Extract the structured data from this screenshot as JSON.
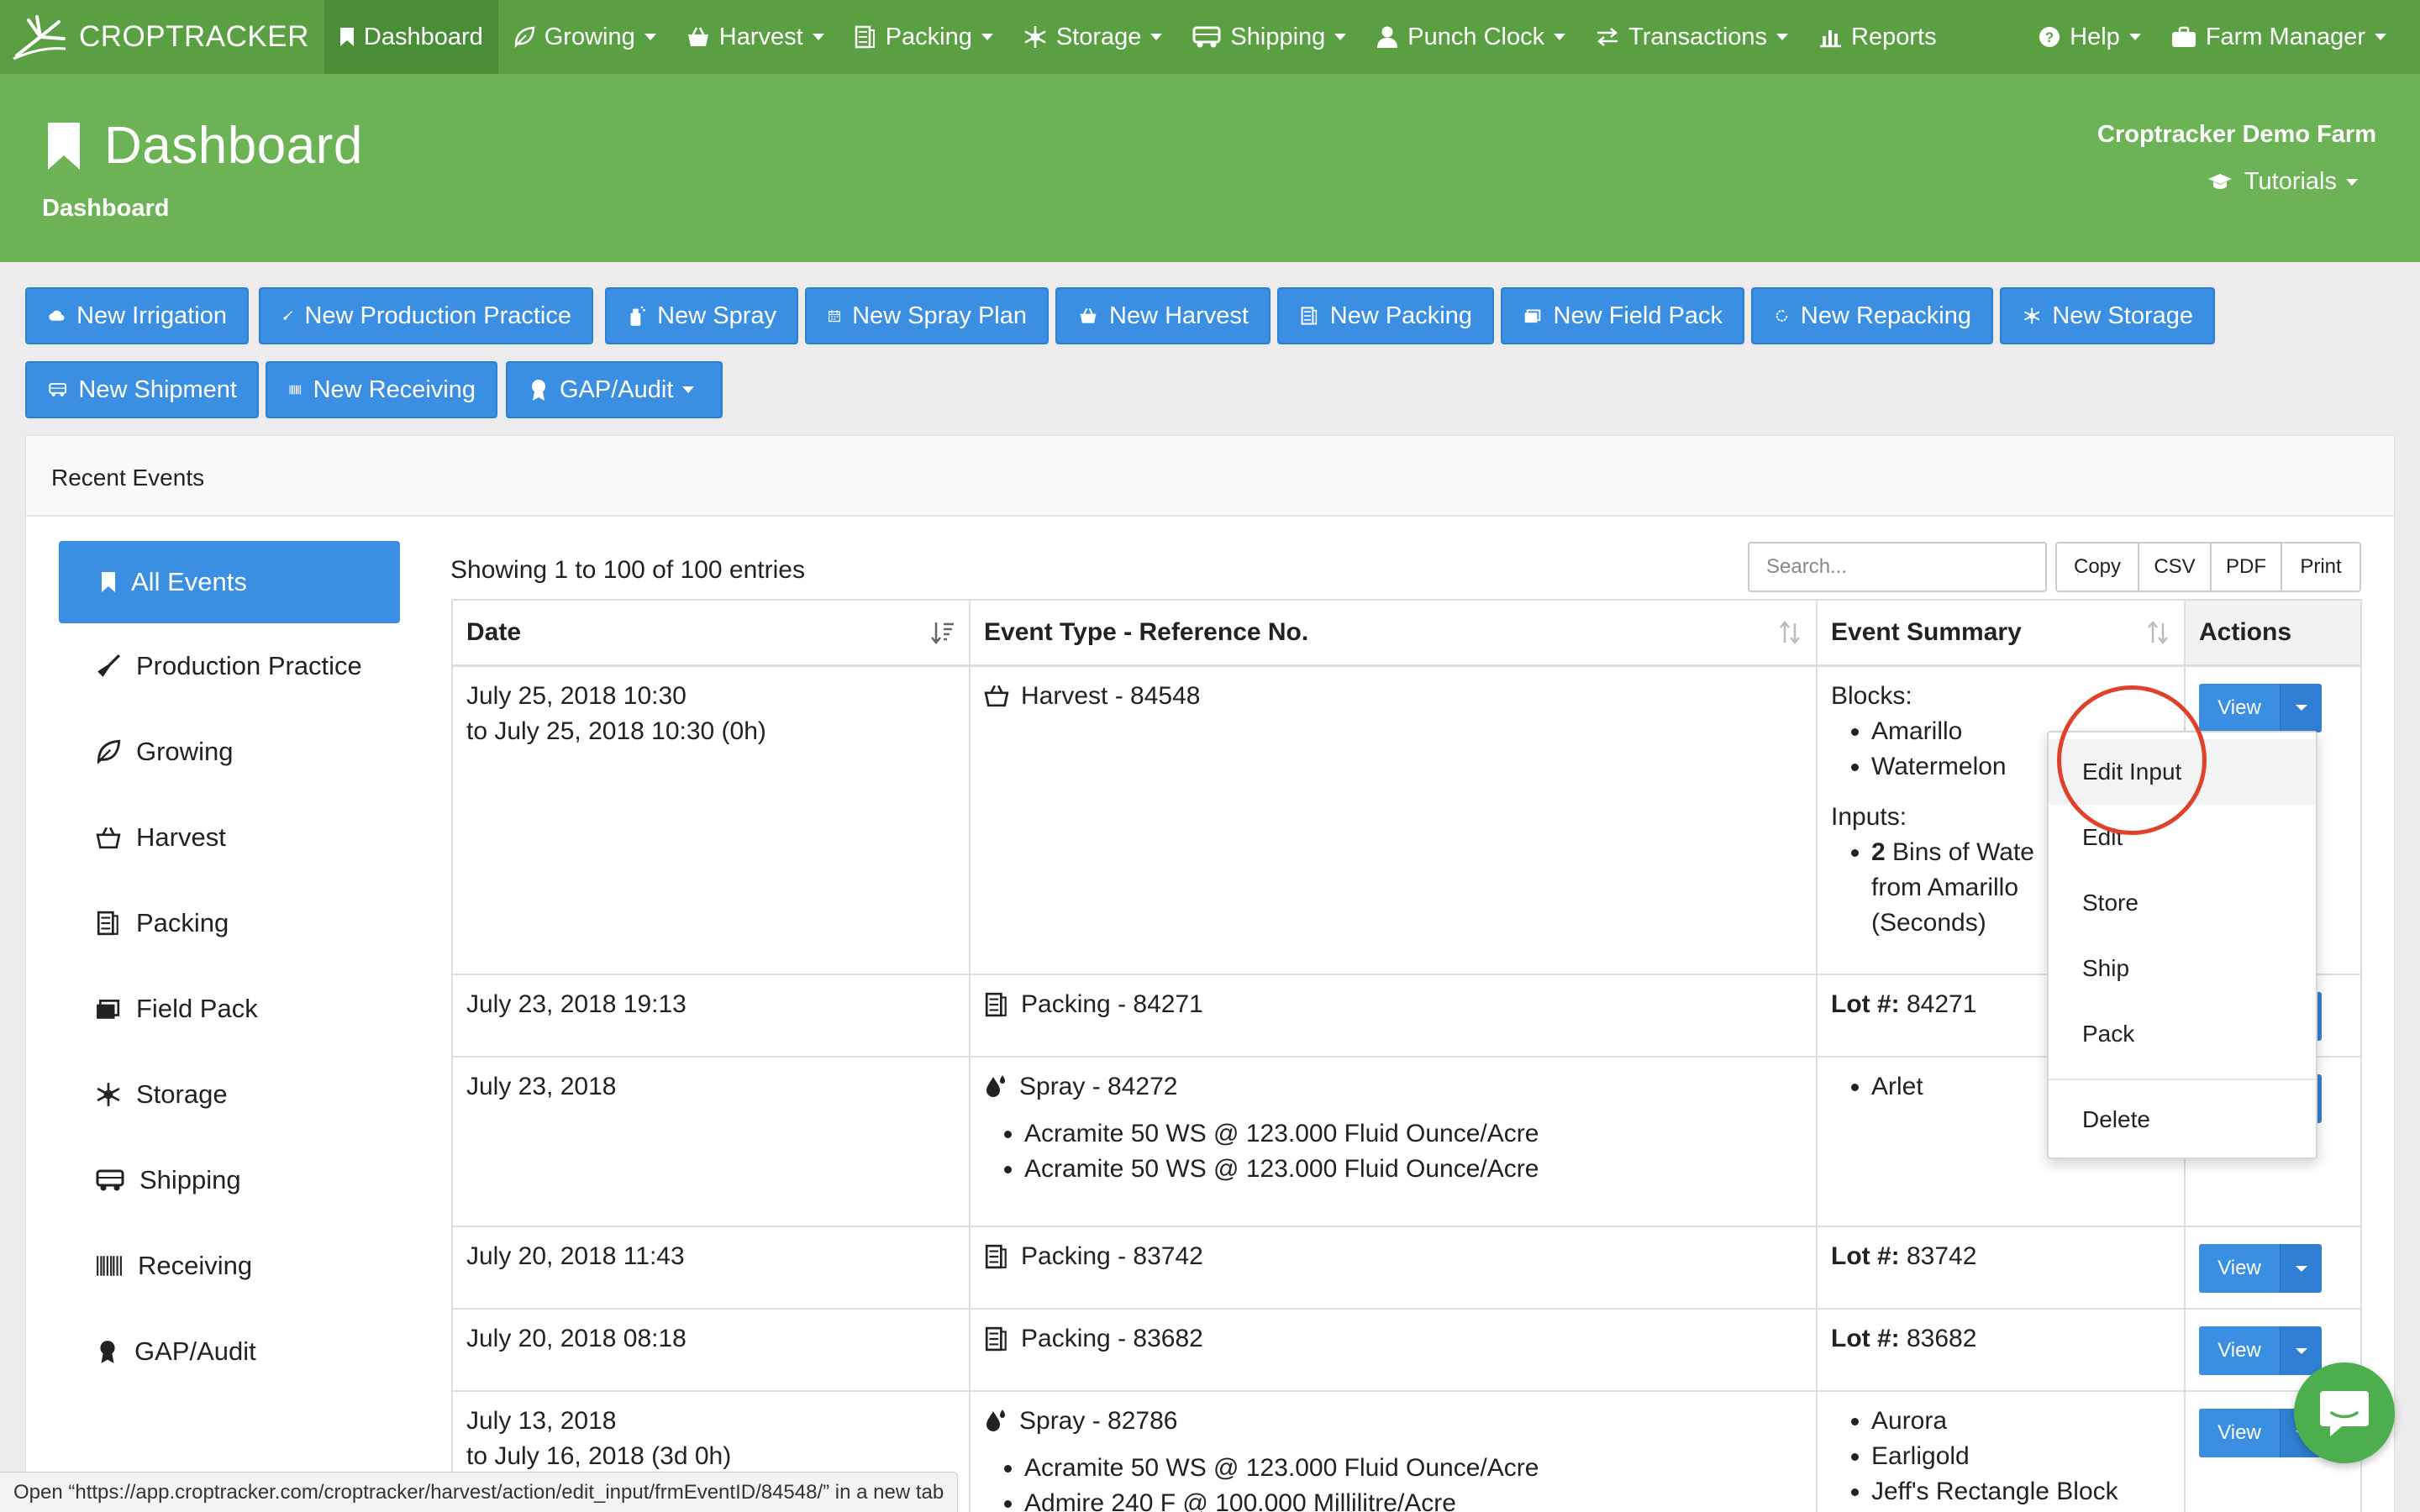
{
  "nav": {
    "brand": "CROPTRACKER",
    "items": [
      {
        "label": "Dashboard",
        "icon": "bookmark-icon",
        "active": true
      },
      {
        "label": "Growing",
        "icon": "leaf-icon"
      },
      {
        "label": "Harvest",
        "icon": "basket-icon"
      },
      {
        "label": "Packing",
        "icon": "boxes-icon"
      },
      {
        "label": "Storage",
        "icon": "snowflake-icon"
      },
      {
        "label": "Shipping",
        "icon": "truck-icon"
      },
      {
        "label": "Punch Clock",
        "icon": "user-icon"
      },
      {
        "label": "Transactions",
        "icon": "exchange-icon"
      },
      {
        "label": "Reports",
        "icon": "bar-chart-icon"
      }
    ],
    "help": "Help",
    "account": "Farm Manager"
  },
  "header": {
    "title": "Dashboard",
    "breadcrumb": "Dashboard",
    "farm": "Croptracker Demo Farm",
    "tutorials": "Tutorials"
  },
  "quick_actions": {
    "new_irrigation": "New Irrigation",
    "new_production_practice": "New Production Practice",
    "new_spray": "New Spray",
    "new_spray_plan": "New Spray Plan",
    "new_harvest": "New Harvest",
    "new_packing": "New Packing",
    "new_field_pack": "New Field Pack",
    "new_repacking": "New Repacking",
    "new_storage": "New Storage",
    "new_shipment": "New Shipment",
    "new_receiving": "New Receiving",
    "gap_audit": "GAP/Audit"
  },
  "recent_events": {
    "title": "Recent Events",
    "showing": "Showing 1 to 100 of 100 entries",
    "search_placeholder": "Search...",
    "export": {
      "copy": "Copy",
      "csv": "CSV",
      "pdf": "PDF",
      "print": "Print"
    },
    "filters": {
      "all": "All Events",
      "production_practice": "Production Practice",
      "growing": "Growing",
      "harvest": "Harvest",
      "packing": "Packing",
      "field_pack": "Field Pack",
      "storage": "Storage",
      "shipping": "Shipping",
      "receiving": "Receiving",
      "gap_audit": "GAP/Audit"
    },
    "columns": {
      "date": "Date",
      "event_type": "Event Type - Reference No.",
      "summary": "Event Summary",
      "actions": "Actions"
    },
    "view_label": "View",
    "rows": [
      {
        "date1": "July 25, 2018 10:30",
        "date2": "to July 25, 2018 10:30 (0h)",
        "type": "Harvest - 84548",
        "blocks_label": "Blocks:",
        "blocks": [
          "Amarillo",
          "Watermelon"
        ],
        "inputs_label": "Inputs:",
        "input_bold": "2",
        "input_line1": " Bins of Wate",
        "input_line2": "from Amarillo",
        "input_line3": "(Seconds)"
      },
      {
        "date1": "July 23, 2018 19:13",
        "type": "Packing - 84271",
        "lot_label": "Lot #:",
        "lot": " 84271"
      },
      {
        "date1": "July 23, 2018",
        "type": "Spray - 84272",
        "products": [
          "Acramite 50 WS @ 123.000 Fluid Ounce/Acre",
          "Acramite 50 WS @ 123.000 Fluid Ounce/Acre"
        ],
        "blocks": [
          "Arlet"
        ]
      },
      {
        "date1": "July 20, 2018 11:43",
        "type": "Packing - 83742",
        "lot_label": "Lot #:",
        "lot": " 83742"
      },
      {
        "date1": "July 20, 2018 08:18",
        "type": "Packing - 83682",
        "lot_label": "Lot #:",
        "lot": " 83682"
      },
      {
        "date1": "July 13, 2018",
        "date2": "to July 16, 2018 (3d 0h)",
        "type": "Spray - 82786",
        "products": [
          "Acramite 50 WS @ 123.000 Fluid Ounce/Acre",
          "Admire 240 F @ 100.000 Millilitre/Acre"
        ],
        "blocks": [
          "Aurora",
          "Earligold",
          "Jeff's Rectangle Block"
        ]
      }
    ]
  },
  "action_menu": {
    "items": [
      "Edit Input",
      "Edit",
      "Store",
      "Ship",
      "Pack",
      "Delete"
    ],
    "highlighted": "Edit Input"
  },
  "status_bar": "Open “https://app.croptracker.com/croptracker/harvest/action/edit_input/frmEventID/84548/” in a new tab",
  "colors": {
    "nav_green": "#5aa043",
    "header_green": "#6cb355",
    "button_blue": "#3a8fe3",
    "highlight_circle": "#e0412c",
    "chat_green": "#4cae4c"
  }
}
